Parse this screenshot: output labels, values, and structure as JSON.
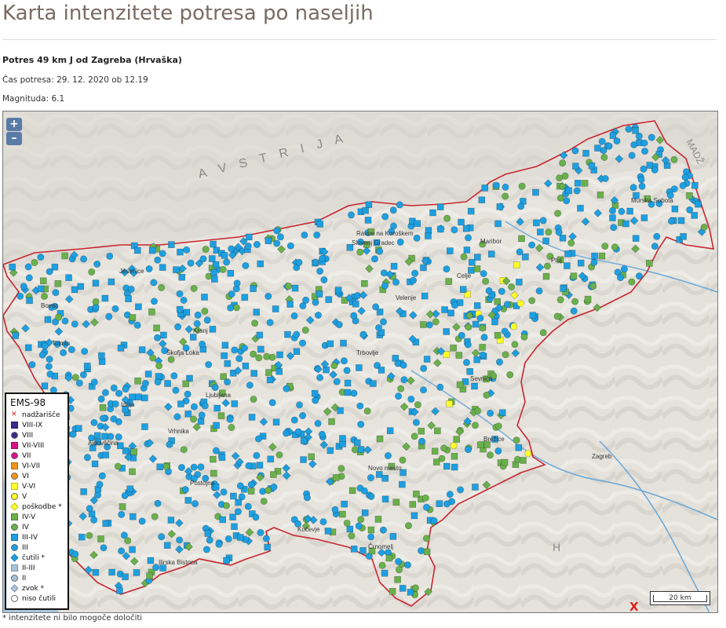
{
  "page": {
    "title": "Karta intenzitete potresa po naseljih",
    "quake_title": "Potres 49 km J od Zagreba (Hrvaška)",
    "time_line": "Čas potresa: 29. 12. 2020 ob 12.19",
    "magnitude_line": "Magnituda: 6.1",
    "footnote": "* intenzitete ni bilo mogoče določiti"
  },
  "map": {
    "zoom_in": "+",
    "zoom_out": "–",
    "scale_label": "20 km",
    "epicenter_mark": "X",
    "labels": {
      "austria": "A V S T R I J A",
      "hungary": "MADŽ",
      "croatia_h": "H",
      "cities": [
        "Maribor",
        "Murska Sobota",
        "Ravne na Koroškem",
        "Slovenj Gradec",
        "Jesenice",
        "Kranj",
        "Škofja Loka",
        "Ljubljana",
        "Celje",
        "Novo mesto",
        "Kočevje",
        "Črnomelj",
        "Postojna",
        "Ilirska Bistrica",
        "Idrija",
        "Zagreb",
        "Bovec",
        "Tolmin",
        "Ajdovščina",
        "Vrhnika",
        "Trbovlje",
        "Ptuj",
        "Velenje",
        "Brežice",
        "Sevnica"
      ]
    }
  },
  "legend": {
    "title": "EMS-98",
    "items": [
      {
        "label": "nadžarišče",
        "shape": "x",
        "color": "#e0201a"
      },
      {
        "label": "VIII-IX",
        "shape": "square",
        "color": "#3b2a8c"
      },
      {
        "label": "VIII",
        "shape": "circle",
        "color": "#3b2a8c"
      },
      {
        "label": "VII-VIII",
        "shape": "square",
        "color": "#d4138a"
      },
      {
        "label": "VII",
        "shape": "circle",
        "color": "#d4138a"
      },
      {
        "label": "VI-VII",
        "shape": "square",
        "color": "#f0961e"
      },
      {
        "label": "VI",
        "shape": "circle",
        "color": "#f0961e"
      },
      {
        "label": "V-VI",
        "shape": "square",
        "color": "#ffff2a"
      },
      {
        "label": "V",
        "shape": "circle",
        "color": "#ffff2a"
      },
      {
        "label": "poškodbe *",
        "shape": "diamond",
        "color": "#ffff2a"
      },
      {
        "label": "IV-V",
        "shape": "square",
        "color": "#6ab04c"
      },
      {
        "label": "IV",
        "shape": "circle",
        "color": "#6ab04c"
      },
      {
        "label": "III-IV",
        "shape": "square",
        "color": "#1e9fe0"
      },
      {
        "label": "III",
        "shape": "circle",
        "color": "#1e9fe0"
      },
      {
        "label": "čutili *",
        "shape": "diamond",
        "color": "#1e9fe0"
      },
      {
        "label": "II-III",
        "shape": "square",
        "color": "#a8c4dc"
      },
      {
        "label": "II",
        "shape": "circle",
        "color": "#a8c4dc"
      },
      {
        "label": "zvok *",
        "shape": "diamond",
        "color": "#a8c4dc"
      },
      {
        "label": "niso čutili",
        "shape": "circle",
        "color": "#ffffff"
      }
    ]
  }
}
